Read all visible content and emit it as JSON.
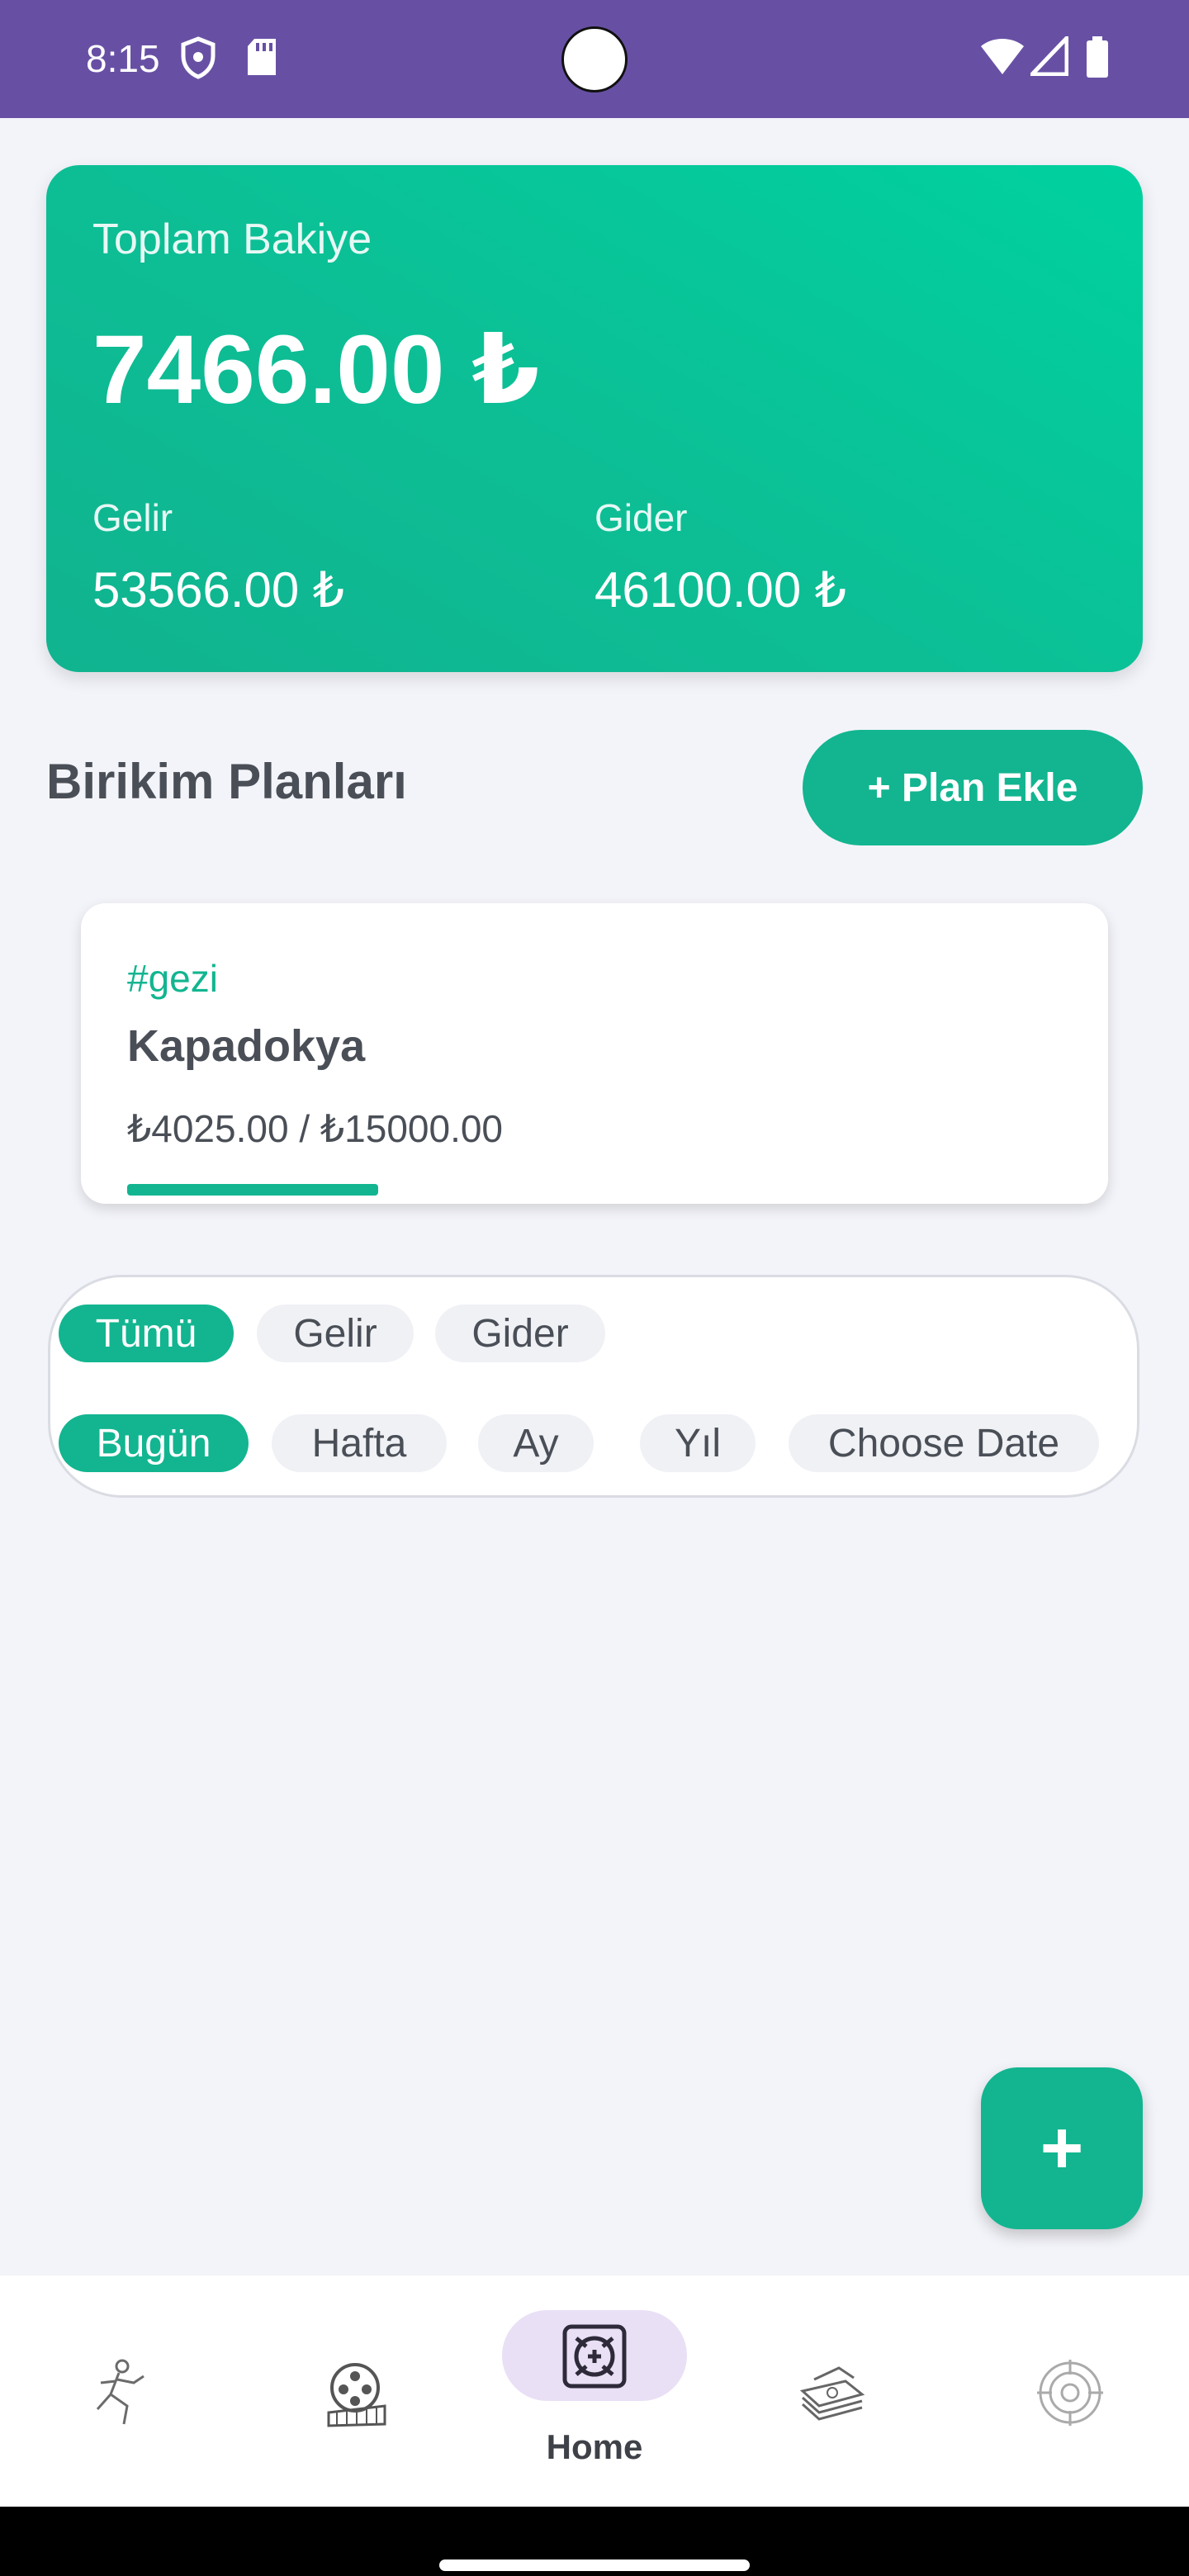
{
  "status_bar": {
    "time": "8:15"
  },
  "balance": {
    "title": "Toplam Bakiye",
    "amount": "7466.00 ₺",
    "income_label": "Gelir",
    "income_value": "53566.00 ₺",
    "expense_label": "Gider",
    "expense_value": "46100.00 ₺"
  },
  "plans": {
    "title": "Birikim Planları",
    "add_button": "+ Plan Ekle",
    "items": [
      {
        "tag": "#gezi",
        "name": "Kapadokya",
        "progress_text": "₺4025.00 / ₺15000.00",
        "progress_fraction": 0.2683
      }
    ]
  },
  "filters": {
    "type_chips": [
      "Tümü",
      "Gelir",
      "Gider"
    ],
    "period_chips": [
      "Bugün",
      "Hafta",
      "Ay",
      "Yıl",
      "Choose Date"
    ],
    "active_type": "Tümü",
    "active_period": "Bugün"
  },
  "fab": {
    "label": "+"
  },
  "bottom_nav": {
    "items": [
      {
        "icon": "runner-icon"
      },
      {
        "icon": "film-reel-icon"
      },
      {
        "icon": "home-emblem-icon",
        "label": "Home",
        "active": true
      },
      {
        "icon": "money-stack-icon"
      },
      {
        "icon": "target-icon"
      }
    ]
  },
  "colors": {
    "accent": "#12B590",
    "header": "#6750A4",
    "active_nav_pill": "#E9E0F6"
  }
}
